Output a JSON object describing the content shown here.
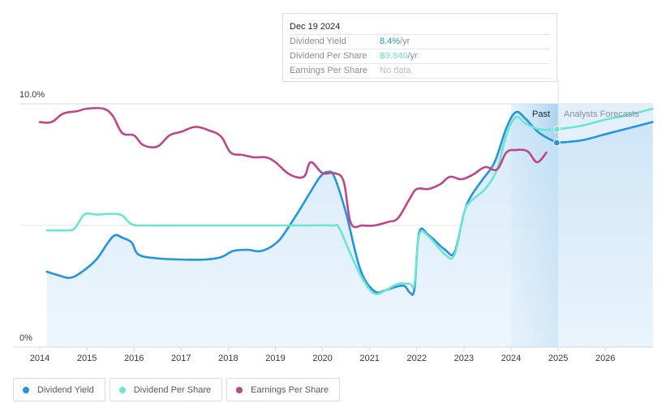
{
  "tooltip": {
    "date": "Dec 19 2024",
    "rows": [
      {
        "label": "Dividend Yield",
        "value": "8.4%",
        "unit": " /yr",
        "color": "#2394df"
      },
      {
        "label": "Dividend Per Share",
        "value": "฿9.840",
        "unit": " /yr",
        "color": "#6ce5d3"
      },
      {
        "label": "Earnings Per Share",
        "value": "No data",
        "unit": "",
        "color": "#b9bec6"
      }
    ]
  },
  "regions": {
    "past_label": "Past",
    "forecast_label": "Analysts Forecasts"
  },
  "legend": [
    {
      "label": "Dividend Yield",
      "color": "#2394df"
    },
    {
      "label": "Dividend Per Share",
      "color": "#6ce5d3"
    },
    {
      "label": "Earnings Per Share",
      "color": "#c0468a"
    }
  ],
  "chart_data": {
    "type": "line",
    "title": "",
    "xlabel": "",
    "ylabel": "",
    "x_ticks": [
      "2014",
      "2015",
      "2016",
      "2017",
      "2018",
      "2019",
      "2020",
      "2021",
      "2022",
      "2023",
      "2024",
      "2025",
      "2026"
    ],
    "y_ticks": [
      "0%",
      "10.0%"
    ],
    "ylim": [
      0,
      10
    ],
    "xlim": [
      2013.8,
      2027.0
    ],
    "grid": true,
    "past_region": [
      2024.0,
      2025.0
    ],
    "forecast_start": 2025.0,
    "highlight_x": 2024.97,
    "series": [
      {
        "name": "Dividend Yield",
        "color": "#2394df",
        "area": true,
        "points": [
          [
            2014.15,
            3.1
          ],
          [
            2014.4,
            2.95
          ],
          [
            2014.65,
            2.85
          ],
          [
            2014.9,
            3.1
          ],
          [
            2015.2,
            3.6
          ],
          [
            2015.45,
            4.3
          ],
          [
            2015.6,
            4.6
          ],
          [
            2015.75,
            4.5
          ],
          [
            2015.95,
            4.3
          ],
          [
            2016.1,
            3.8
          ],
          [
            2016.5,
            3.65
          ],
          [
            2017.0,
            3.6
          ],
          [
            2017.5,
            3.6
          ],
          [
            2017.85,
            3.7
          ],
          [
            2018.1,
            3.95
          ],
          [
            2018.4,
            4.0
          ],
          [
            2018.7,
            3.95
          ],
          [
            2019.0,
            4.25
          ],
          [
            2019.2,
            4.7
          ],
          [
            2019.5,
            5.6
          ],
          [
            2019.75,
            6.4
          ],
          [
            2019.95,
            7.0
          ],
          [
            2020.1,
            7.2
          ],
          [
            2020.25,
            7.0
          ],
          [
            2020.5,
            5.5
          ],
          [
            2020.8,
            3.2
          ],
          [
            2021.1,
            2.3
          ],
          [
            2021.35,
            2.35
          ],
          [
            2021.6,
            2.5
          ],
          [
            2021.75,
            2.5
          ],
          [
            2021.85,
            2.25
          ],
          [
            2021.95,
            2.4
          ],
          [
            2022.05,
            4.7
          ],
          [
            2022.25,
            4.6
          ],
          [
            2022.6,
            4.0
          ],
          [
            2022.8,
            3.9
          ],
          [
            2023.0,
            5.5
          ],
          [
            2023.15,
            6.2
          ],
          [
            2023.4,
            6.9
          ],
          [
            2023.65,
            7.6
          ],
          [
            2023.9,
            9.0
          ],
          [
            2024.1,
            9.65
          ],
          [
            2024.3,
            9.4
          ],
          [
            2024.6,
            8.8
          ],
          [
            2024.97,
            8.4
          ]
        ],
        "forecast": [
          [
            2024.97,
            8.4
          ],
          [
            2025.5,
            8.5
          ],
          [
            2026.0,
            8.75
          ],
          [
            2026.5,
            9.0
          ],
          [
            2027.0,
            9.25
          ]
        ]
      },
      {
        "name": "Dividend Per Share",
        "color": "#6ce5d3",
        "area": false,
        "points": [
          [
            2014.15,
            4.8
          ],
          [
            2014.6,
            4.8
          ],
          [
            2014.75,
            4.9
          ],
          [
            2014.95,
            5.45
          ],
          [
            2015.2,
            5.45
          ],
          [
            2015.7,
            5.45
          ],
          [
            2015.95,
            5.05
          ],
          [
            2016.3,
            5.0
          ],
          [
            2017.0,
            5.0
          ],
          [
            2018.0,
            5.0
          ],
          [
            2019.0,
            5.0
          ],
          [
            2019.5,
            5.0
          ],
          [
            2020.2,
            5.0
          ],
          [
            2020.35,
            4.9
          ],
          [
            2020.6,
            3.8
          ],
          [
            2020.85,
            2.8
          ],
          [
            2021.1,
            2.2
          ],
          [
            2021.35,
            2.35
          ],
          [
            2021.6,
            2.6
          ],
          [
            2021.85,
            2.6
          ],
          [
            2021.95,
            2.6
          ],
          [
            2022.05,
            4.6
          ],
          [
            2022.25,
            4.55
          ],
          [
            2022.6,
            3.8
          ],
          [
            2022.8,
            3.8
          ],
          [
            2023.0,
            5.5
          ],
          [
            2023.15,
            6.0
          ],
          [
            2023.45,
            6.5
          ],
          [
            2023.7,
            7.3
          ],
          [
            2023.9,
            8.7
          ],
          [
            2024.1,
            9.45
          ],
          [
            2024.3,
            9.2
          ],
          [
            2024.6,
            8.95
          ],
          [
            2024.97,
            8.95
          ]
        ],
        "forecast": [
          [
            2024.97,
            8.95
          ],
          [
            2025.5,
            9.1
          ],
          [
            2026.0,
            9.35
          ],
          [
            2026.5,
            9.55
          ],
          [
            2027.0,
            9.8
          ]
        ]
      },
      {
        "name": "Earnings Per Share",
        "color": "#c0468a",
        "area": false,
        "points": [
          [
            2014.0,
            9.25
          ],
          [
            2014.25,
            9.25
          ],
          [
            2014.5,
            9.6
          ],
          [
            2014.8,
            9.7
          ],
          [
            2015.0,
            9.8
          ],
          [
            2015.35,
            9.8
          ],
          [
            2015.55,
            9.5
          ],
          [
            2015.75,
            8.8
          ],
          [
            2016.0,
            8.7
          ],
          [
            2016.2,
            8.3
          ],
          [
            2016.5,
            8.25
          ],
          [
            2016.75,
            8.7
          ],
          [
            2017.0,
            8.85
          ],
          [
            2017.3,
            9.05
          ],
          [
            2017.6,
            8.9
          ],
          [
            2017.85,
            8.65
          ],
          [
            2018.05,
            8.0
          ],
          [
            2018.3,
            7.9
          ],
          [
            2018.55,
            7.8
          ],
          [
            2018.8,
            7.8
          ],
          [
            2019.0,
            7.6
          ],
          [
            2019.3,
            7.1
          ],
          [
            2019.6,
            7.0
          ],
          [
            2019.75,
            7.6
          ],
          [
            2020.0,
            7.15
          ],
          [
            2020.25,
            7.15
          ],
          [
            2020.45,
            6.8
          ],
          [
            2020.6,
            5.1
          ],
          [
            2020.85,
            5.0
          ],
          [
            2021.1,
            5.0
          ],
          [
            2021.4,
            5.15
          ],
          [
            2021.6,
            5.3
          ],
          [
            2021.85,
            6.1
          ],
          [
            2022.0,
            6.5
          ],
          [
            2022.25,
            6.5
          ],
          [
            2022.5,
            6.7
          ],
          [
            2022.7,
            7.0
          ],
          [
            2022.95,
            6.9
          ],
          [
            2023.2,
            7.1
          ],
          [
            2023.45,
            7.4
          ],
          [
            2023.7,
            7.3
          ],
          [
            2023.9,
            8.0
          ],
          [
            2024.1,
            8.1
          ],
          [
            2024.35,
            8.05
          ],
          [
            2024.55,
            7.6
          ],
          [
            2024.75,
            8.0
          ]
        ]
      }
    ]
  }
}
